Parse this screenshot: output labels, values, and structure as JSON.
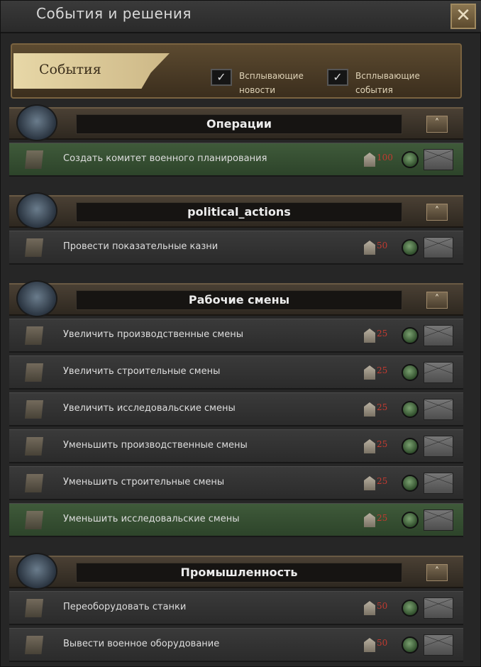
{
  "window": {
    "title": "События и решения",
    "close_label": "✕"
  },
  "header": {
    "tab_label": "События",
    "checkboxes": [
      {
        "line1": "Всплывающие",
        "line2": "новости",
        "checked": true
      },
      {
        "line1": "Всплывающие",
        "line2": "события",
        "checked": true
      }
    ]
  },
  "categories": [
    {
      "name": "Операции",
      "collapse_label": "˄",
      "decisions": [
        {
          "label": "Создать комитет военного планирования",
          "cost": "100",
          "highlighted": true
        }
      ]
    },
    {
      "name": "political_actions",
      "collapse_label": "˄",
      "decisions": [
        {
          "label": "Провести показательные казни",
          "cost": "50",
          "highlighted": false
        }
      ]
    },
    {
      "name": "Рабочие смены",
      "collapse_label": "˄",
      "decisions": [
        {
          "label": "Увеличить производственные смены",
          "cost": "25",
          "highlighted": false
        },
        {
          "label": "Увеличить строительные смены",
          "cost": "25",
          "highlighted": false
        },
        {
          "label": "Увеличить исследовальские смены",
          "cost": "25",
          "highlighted": false
        },
        {
          "label": "Уменьшить производственные смены",
          "cost": "25",
          "highlighted": false
        },
        {
          "label": "Уменьшить строительные смены",
          "cost": "25",
          "highlighted": false
        },
        {
          "label": "Уменьшить исследовальские смены",
          "cost": "25",
          "highlighted": true
        }
      ]
    },
    {
      "name": "Промышленность",
      "collapse_label": "˄",
      "decisions": [
        {
          "label": "Переоборудовать станки",
          "cost": "50",
          "highlighted": false
        },
        {
          "label": "Вывести военное оборудование",
          "cost": "50",
          "highlighted": false
        }
      ]
    }
  ],
  "colors": {
    "accent": "#7a6340",
    "highlight_row": "#3f5a3a",
    "cost_text": "#c23a30"
  },
  "icons": {
    "cost": "political-power-icon",
    "status": "available-indicator-icon",
    "action": "envelope-icon",
    "check": "checkmark-icon"
  }
}
